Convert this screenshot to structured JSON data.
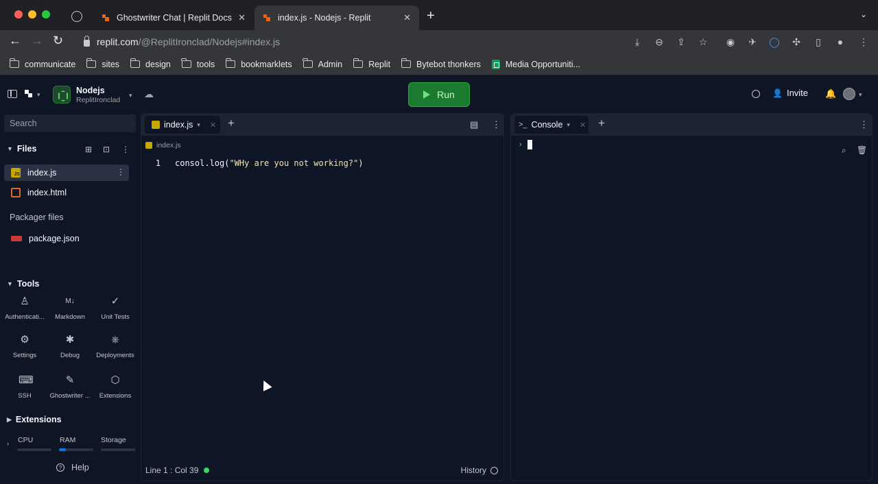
{
  "browser": {
    "tabs": [
      {
        "title": "Ghostwriter Chat | Replit Docs",
        "active": false
      },
      {
        "title": "index.js - Nodejs - Replit",
        "active": true
      }
    ],
    "url_host": "replit.com",
    "url_path": "/@ReplitIronclad/Nodejs#index.js",
    "bookmarks": [
      "communicate",
      "sites",
      "design",
      "tools",
      "bookmarklets",
      "Admin",
      "Replit",
      "Bytebot thonkers",
      "Media Opportuniti..."
    ]
  },
  "repl": {
    "name": "Nodejs",
    "owner": "ReplitIronclad",
    "run_label": "Run",
    "invite_label": "Invite"
  },
  "sidebar": {
    "search_placeholder": "Search",
    "files_header": "Files",
    "files": [
      {
        "name": "index.js",
        "type": "js",
        "selected": true
      },
      {
        "name": "index.html",
        "type": "html",
        "selected": false
      }
    ],
    "packager_header": "Packager files",
    "packager_files": [
      {
        "name": "package.json",
        "type": "npm"
      }
    ],
    "tools_header": "Tools",
    "tools": [
      {
        "label": "Authenticati...",
        "icon": "person-icon"
      },
      {
        "label": "Markdown",
        "icon": "markdown-icon"
      },
      {
        "label": "Unit Tests",
        "icon": "check-icon"
      },
      {
        "label": "Settings",
        "icon": "gear-icon"
      },
      {
        "label": "Debug",
        "icon": "bug-icon"
      },
      {
        "label": "Deployments",
        "icon": "deploy-icon"
      },
      {
        "label": "SSH",
        "icon": "keyboard-icon"
      },
      {
        "label": "Ghostwriter ...",
        "icon": "ghostwriter-icon"
      },
      {
        "label": "Extensions",
        "icon": "puzzle-icon"
      }
    ],
    "extensions_header": "Extensions",
    "resources": [
      {
        "label": "CPU",
        "level": 0.0
      },
      {
        "label": "RAM",
        "level": 0.2
      },
      {
        "label": "Storage",
        "level": 0.0
      }
    ],
    "help_label": "Help"
  },
  "editor": {
    "tab_label": "index.js",
    "breadcrumb": "index.js",
    "lines": [
      {
        "number": "1",
        "code_ident": "consol.log(",
        "code_str": "\"WHy are you not working?\"",
        "code_end": ")"
      }
    ],
    "status": "Line 1 : Col 39",
    "history_label": "History"
  },
  "console": {
    "tab_label": "Console"
  },
  "colors": {
    "background": "#0e1525",
    "panel": "#1c2333",
    "run_green": "#1a7a2e",
    "accent_blue": "#0079f2"
  }
}
